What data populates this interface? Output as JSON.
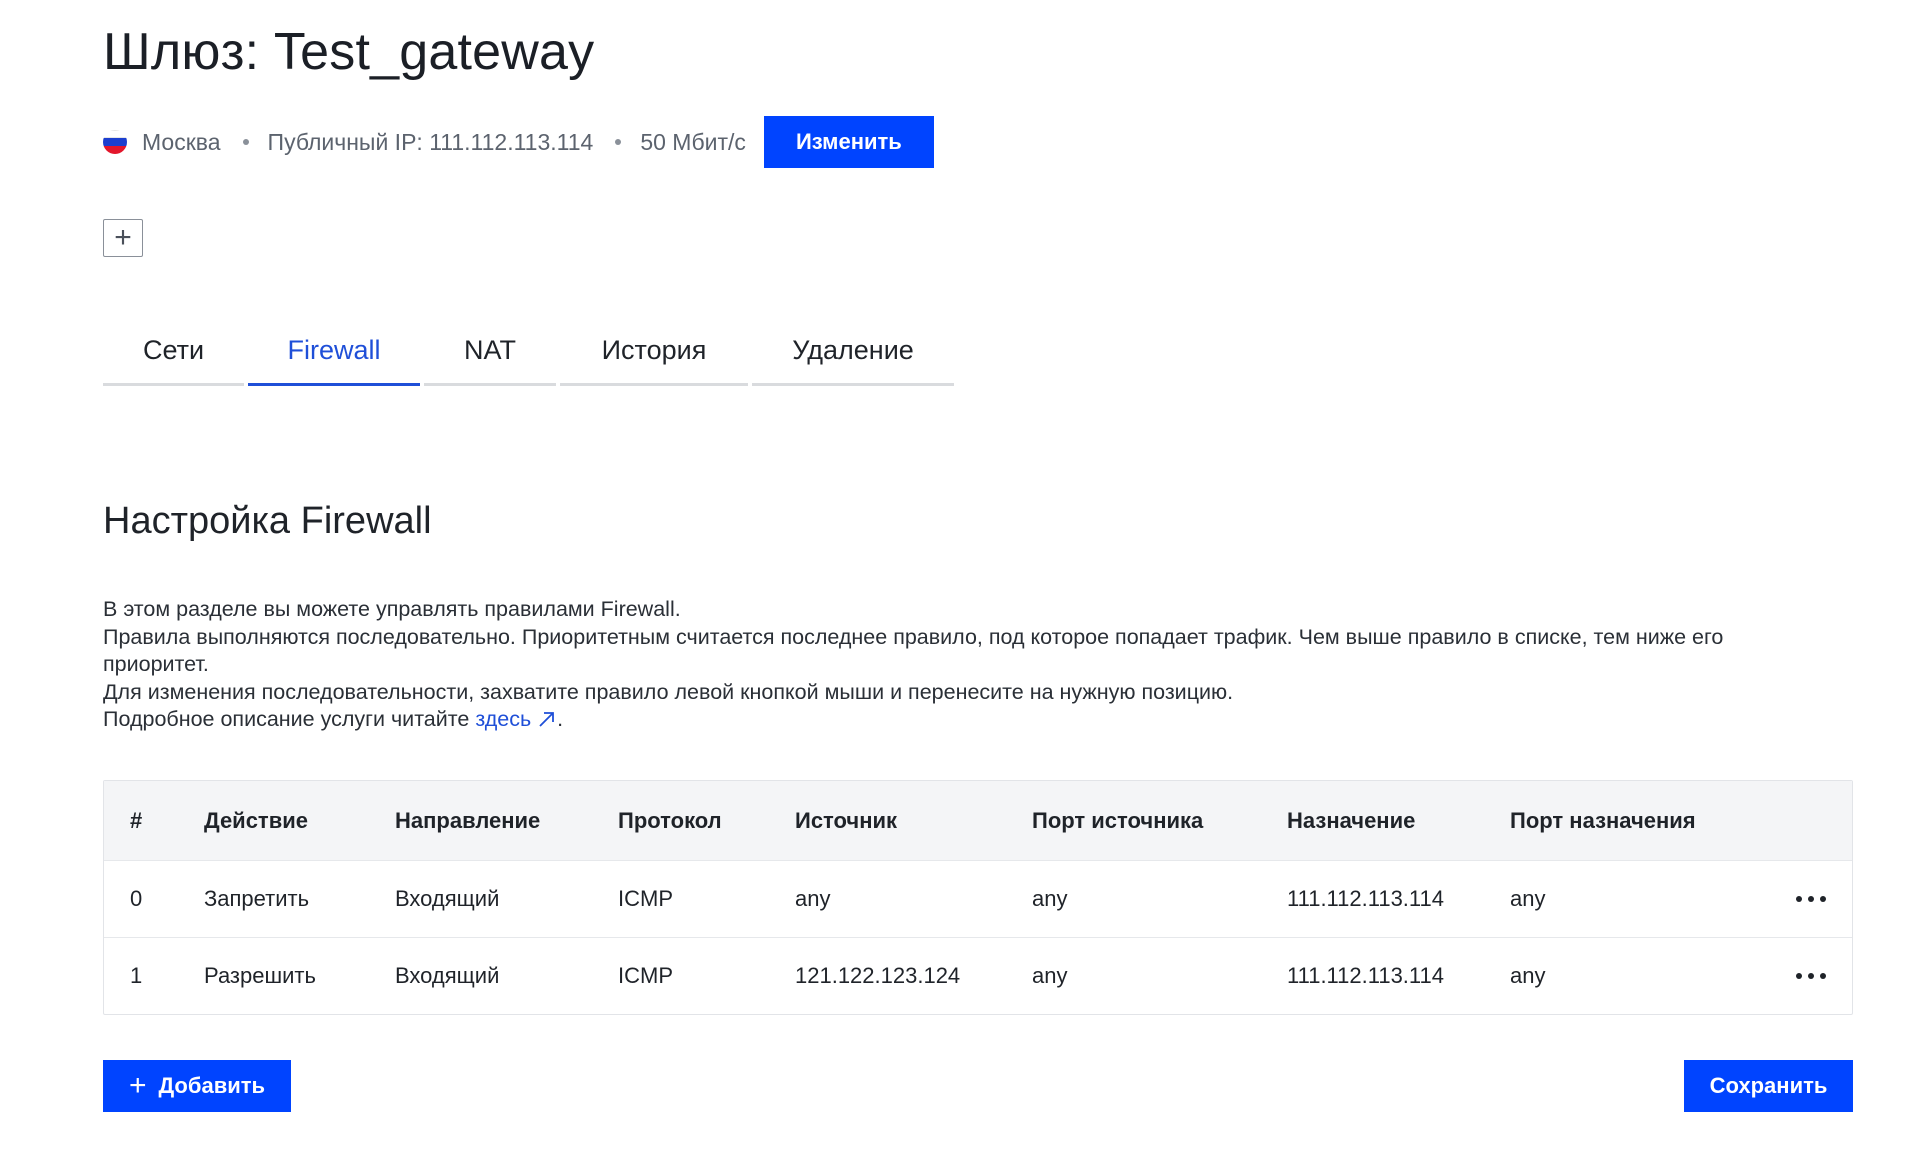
{
  "header": {
    "title": "Шлюз: Test_gateway",
    "location": "Москва",
    "public_ip": "Публичный IP: 111.112.113.114",
    "bandwidth": "50 Мбит/с",
    "edit_label": "Изменить",
    "flag_colors": [
      "#ffffff",
      "#1c3fcf",
      "#e3162b"
    ]
  },
  "tabs": [
    {
      "label": "Сети",
      "active": false
    },
    {
      "label": "Firewall",
      "active": true
    },
    {
      "label": "NAT",
      "active": false
    },
    {
      "label": "История",
      "active": false
    },
    {
      "label": "Удаление",
      "active": false
    }
  ],
  "section": {
    "title": "Настройка Firewall",
    "line1": "В этом разделе вы можете управлять правилами Firewall.",
    "line2": "Правила выполняются последовательно. Приоритетным считается последнее правило, под которое попадает трафик. Чем выше правило в списке, тем ниже его приоритет.",
    "line3": "Для изменения последовательности, захватите правило левой кнопкой мыши и перенесите на нужную позицию.",
    "line4_prefix": "Подробное описание услуги читайте ",
    "line4_link": "здесь",
    "line4_suffix": "."
  },
  "table": {
    "columns": [
      "#",
      "Действие",
      "Направление",
      "Протокол",
      "Источник",
      "Порт источника",
      "Назначение",
      "Порт назначения"
    ],
    "rows": [
      [
        "0",
        "Запретить",
        "Входящий",
        "ICMP",
        "any",
        "any",
        "111.112.113.114",
        "any"
      ],
      [
        "1",
        "Разрешить",
        "Входящий",
        "ICMP",
        "121.122.123.124",
        "any",
        "111.112.113.114",
        "any"
      ]
    ]
  },
  "footer": {
    "add_label": "Добавить",
    "save_label": "Сохранить"
  },
  "colors": {
    "accent": "#0044ff",
    "link": "#1f4fd8",
    "table_header_bg": "#f4f5f7"
  }
}
